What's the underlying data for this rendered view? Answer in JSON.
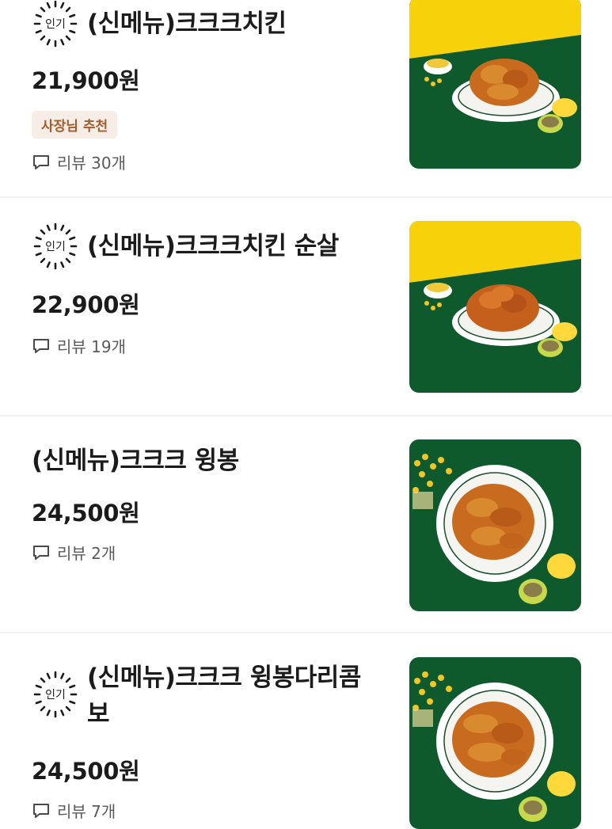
{
  "menu": {
    "items": [
      {
        "name": "(신메뉴)크크크치킨",
        "popular_label": "인기",
        "price": "21,900원",
        "tag": "사장님 추천",
        "review_label": "리뷰",
        "review_count": "30개",
        "image": "chicken-plate-yellow-green"
      },
      {
        "name": "(신메뉴)크크크치킨 순살",
        "popular_label": "인기",
        "price": "22,900원",
        "review_label": "리뷰",
        "review_count": "19개",
        "image": "boneless-chicken-plate-yellow-green"
      },
      {
        "name": "(신메뉴)크크크 윙봉",
        "price": "24,500원",
        "review_label": "리뷰",
        "review_count": "2개",
        "image": "wing-plate-green"
      },
      {
        "name_line1": "(신메뉴)크크크 윙봉다리콤",
        "name_line2": "보",
        "popular_label": "인기",
        "price": "24,500원",
        "review_label": "리뷰",
        "review_count": "7개",
        "image": "wing-drum-combo-plate-green"
      }
    ]
  },
  "colors": {
    "tag_bg": "#f6ede6",
    "tag_text": "#a35c2e",
    "thumb_green": "#0f5a2c",
    "thumb_yellow": "#f7d10a"
  }
}
